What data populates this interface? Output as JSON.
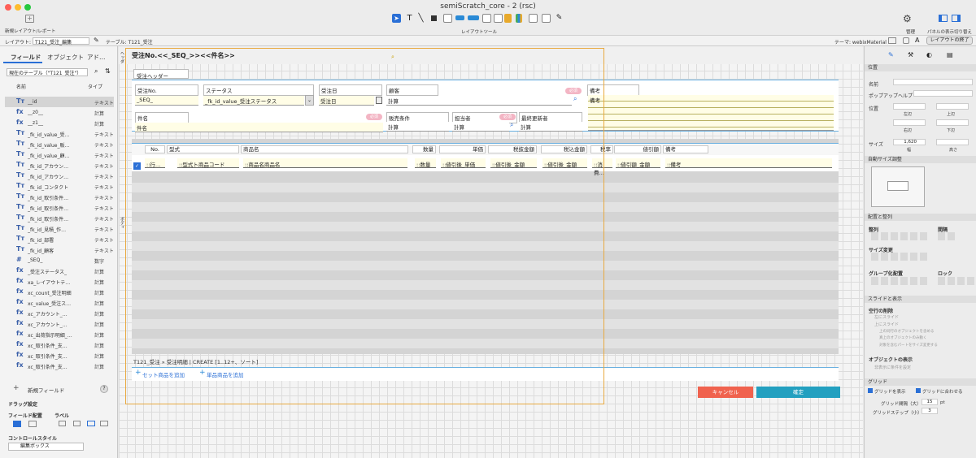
{
  "window": {
    "title": "semiScratch_core - 2 (rsc)"
  },
  "toolbar": {
    "new_layout": "新規レイアウト/レポート",
    "layout_tools": "レイアウトツール",
    "manage": "管理",
    "panel_toggle": "パネルの表示切り替え"
  },
  "options": {
    "layout_label": "レイアウト:",
    "layout_value": "T121_受注_編集",
    "table_label": "テーブル: T121_受注",
    "theme": "テーマ: webixMaterial",
    "exit_layout": "レイアウトの終了"
  },
  "left": {
    "tabs": [
      "フィールド",
      "オブジェクト",
      "アド…"
    ],
    "table_select": "現在のテーブル（\"T121_受注\"）",
    "col_name": "名前",
    "col_type": "タイプ",
    "fields": [
      {
        "icon": "Tт",
        "name": "__id",
        "type": "テキスト"
      },
      {
        "icon": "fx",
        "name": "__z0__",
        "type": "計算"
      },
      {
        "icon": "fx",
        "name": "__z1__",
        "type": "計算"
      },
      {
        "icon": "Tт",
        "name": "_fk_id_value_受…",
        "type": "テキスト"
      },
      {
        "icon": "Tт",
        "name": "_fk_id_value_販…",
        "type": "テキスト"
      },
      {
        "icon": "Tт",
        "name": "_fk_id_value_顧…",
        "type": "テキスト"
      },
      {
        "icon": "Tт",
        "name": "_fk_id_アカウン…",
        "type": "テキスト"
      },
      {
        "icon": "Tт",
        "name": "_fk_id_アカウン…",
        "type": "テキスト"
      },
      {
        "icon": "Tт",
        "name": "_fk_id_コンタクト",
        "type": "テキスト"
      },
      {
        "icon": "Tт",
        "name": "_fk_id_取引条件…",
        "type": "テキスト"
      },
      {
        "icon": "Tт",
        "name": "_fk_id_取引条件…",
        "type": "テキスト"
      },
      {
        "icon": "Tт",
        "name": "_fk_id_取引条件…",
        "type": "テキスト"
      },
      {
        "icon": "Tт",
        "name": "_fk_id_見積_作…",
        "type": "テキスト"
      },
      {
        "icon": "Tт",
        "name": "_fk_id_部署",
        "type": "テキスト"
      },
      {
        "icon": "Tт",
        "name": "_fk_id_顧客",
        "type": "テキスト"
      },
      {
        "icon": "#",
        "name": "_SEQ_",
        "type": "数字"
      },
      {
        "icon": "fx",
        "name": "_受注ステータス_",
        "type": "計算"
      },
      {
        "icon": "fx",
        "name": "xa_レイアウトテ…",
        "type": "計算"
      },
      {
        "icon": "fx",
        "name": "xc_count_受注明細",
        "type": "計算"
      },
      {
        "icon": "fx",
        "name": "xc_value_受注ス…",
        "type": "計算"
      },
      {
        "icon": "fx",
        "name": "xc_アカウント_…",
        "type": "計算"
      },
      {
        "icon": "fx",
        "name": "xc_アカウント_…",
        "type": "計算"
      },
      {
        "icon": "fx",
        "name": "xc_出荷指示明細_…",
        "type": "計算"
      },
      {
        "icon": "fx",
        "name": "xc_取引条件_支…",
        "type": "計算"
      },
      {
        "icon": "fx",
        "name": "xc_取引条件_支…",
        "type": "計算"
      },
      {
        "icon": "fx",
        "name": "xc_取引条件_支…",
        "type": "計算"
      }
    ],
    "new_field": "新規フィールド",
    "help": "?",
    "drag_settings": "ドラッグ設定",
    "field_placement": "フィールド配置",
    "label": "ラベル",
    "control_style": "コントロールスタイル",
    "control_value": "編集ボックス"
  },
  "canvas": {
    "header_title": "受注No.<<_SEQ_>><<件名>>",
    "section_tab": "受注ヘッダー",
    "labels": {
      "order_no": "受注No.",
      "status": "ステータス",
      "order_date": "受注日",
      "customer": "顧客",
      "remarks": "備考",
      "subject": "件名",
      "sales_terms": "販売条件",
      "owner": "担当者",
      "last_modifier": "最終更新者"
    },
    "values": {
      "order_no": "_SEQ_",
      "status": "_fk_id_value_受注ステータス",
      "order_date": "受注日",
      "customer": "計算",
      "remarks": "備考",
      "subject": "件名",
      "sales_terms": "計算",
      "owner": "計算",
      "last_modifier": "計算"
    },
    "badge": "必須",
    "columns": [
      "No.",
      "型式",
      "商品名",
      "数量",
      "単価",
      "税抜金額",
      "税込金額",
      "税率",
      "値引額",
      "備考"
    ],
    "line": [
      "::行…",
      "::型式ト商品コード",
      "::商品名商品名",
      "::数量",
      "::値引後_単価",
      "::値引後_金額",
      "::値引後_金額",
      "::消費…",
      "::値引額_金額",
      "::備考"
    ],
    "portal_caption": "T121_受注 » 受注明細 | CREATE [1..12+、ソート]",
    "add_set": "セット商品を追加",
    "add_single": "単品商品を追加",
    "cancel": "キャンセル",
    "confirm": "確定",
    "side_header": "ヘッダ",
    "side_body": "ボディ"
  },
  "right": {
    "position": "位置",
    "name_label": "名前",
    "popover_help": "ポップアップヘルプ",
    "pos_label": "位置",
    "left": "左辺",
    "top": "上辺",
    "right": "右辺",
    "bottom": "下辺",
    "size_label": "サイズ",
    "width_val": "1,620",
    "width": "幅",
    "height": "高さ",
    "autosize": "自動サイズ調整",
    "arrange": "配置と整列",
    "align": "整列",
    "spacing": "間隔",
    "resize": "サイズ変更",
    "group": "グループ化",
    "arrange2": "配置",
    "lock": "ロック",
    "slide": "スライドと表示",
    "blank_remove": "空行の削除",
    "slide_left": "左にスライド",
    "slide_up": "上にスライド",
    "slide_up_opt1": "上の同行のオブジェクトを含める",
    "slide_up_opt2": "真上のオブジェクトのみ動く",
    "slide_up_opt3": "対象を含むパートをサイズ変更する",
    "visibility": "オブジェクトの表示",
    "hide_cond": "非表示に条件を設定",
    "grid": "グリッド",
    "show_grid": "グリッドを表示",
    "snap_grid": "グリッドに合わせる",
    "grid_spacing": "グリッド間隔（大）:",
    "grid_spacing_val": "15",
    "unit": "pt",
    "grid_step": "グリッドステップ（小）:",
    "grid_step_val": "3"
  }
}
